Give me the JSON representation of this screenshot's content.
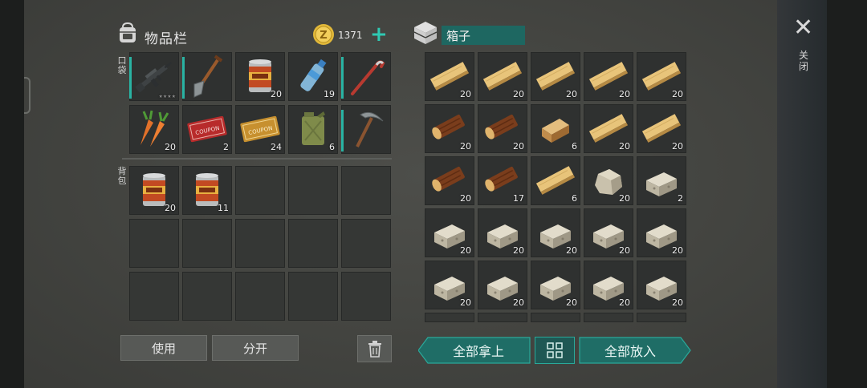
{
  "inventory": {
    "title": "物品栏",
    "coins": "1371",
    "pockets_label": "口袋",
    "backpack_label": "背包",
    "pocket_slots": [
      {
        "icon": "rifle-icon",
        "qty": "",
        "stars": "★★★★"
      },
      {
        "icon": "shovel-icon",
        "qty": ""
      },
      {
        "icon": "canned-food-icon",
        "qty": "20"
      },
      {
        "icon": "water-bottle-icon",
        "qty": "19"
      },
      {
        "icon": "crowbar-icon",
        "qty": ""
      },
      {
        "icon": "carrot-icon",
        "qty": "20"
      },
      {
        "icon": "red-coupon-icon",
        "qty": "2",
        "text": "COUPON"
      },
      {
        "icon": "gold-coupon-icon",
        "qty": "24",
        "text": "COUPON"
      },
      {
        "icon": "jerrycan-icon",
        "qty": "6"
      },
      {
        "icon": "pickaxe-icon",
        "qty": ""
      }
    ],
    "backpack_slots": [
      {
        "icon": "canned-food-icon",
        "qty": "20"
      },
      {
        "icon": "canned-food-icon",
        "qty": "11"
      }
    ],
    "use_label": "使用",
    "split_label": "分开"
  },
  "box": {
    "title": "箱子",
    "slots": [
      {
        "icon": "plank-icon",
        "qty": "20"
      },
      {
        "icon": "plank-icon",
        "qty": "20"
      },
      {
        "icon": "plank-icon",
        "qty": "20"
      },
      {
        "icon": "plank-icon",
        "qty": "20"
      },
      {
        "icon": "plank-icon",
        "qty": "20"
      },
      {
        "icon": "log-icon",
        "qty": "20"
      },
      {
        "icon": "log-icon",
        "qty": "20"
      },
      {
        "icon": "wood-block-icon",
        "qty": "6"
      },
      {
        "icon": "plank-icon",
        "qty": "20"
      },
      {
        "icon": "plank-icon",
        "qty": "20"
      },
      {
        "icon": "log-icon",
        "qty": "20"
      },
      {
        "icon": "log-icon",
        "qty": "17"
      },
      {
        "icon": "plank-icon",
        "qty": "6"
      },
      {
        "icon": "raw-stone-icon",
        "qty": "20"
      },
      {
        "icon": "stone-block-icon",
        "qty": "2"
      },
      {
        "icon": "stone-block-icon",
        "qty": "20"
      },
      {
        "icon": "stone-block-icon",
        "qty": "20"
      },
      {
        "icon": "stone-block-icon",
        "qty": "20"
      },
      {
        "icon": "stone-block-icon",
        "qty": "20"
      },
      {
        "icon": "stone-block-icon",
        "qty": "20"
      },
      {
        "icon": "stone-block-icon",
        "qty": "20"
      },
      {
        "icon": "stone-block-icon",
        "qty": "20"
      },
      {
        "icon": "stone-block-icon",
        "qty": "20"
      },
      {
        "icon": "stone-block-icon",
        "qty": "20"
      },
      {
        "icon": "stone-block-icon",
        "qty": "20"
      }
    ],
    "take_all_label": "全部拿上",
    "put_all_label": "全部放入"
  },
  "close_label": "关闭",
  "colors": {
    "accent": "#1f6d66",
    "highlight": "#29b3a3",
    "coin": "#e2b93a"
  }
}
